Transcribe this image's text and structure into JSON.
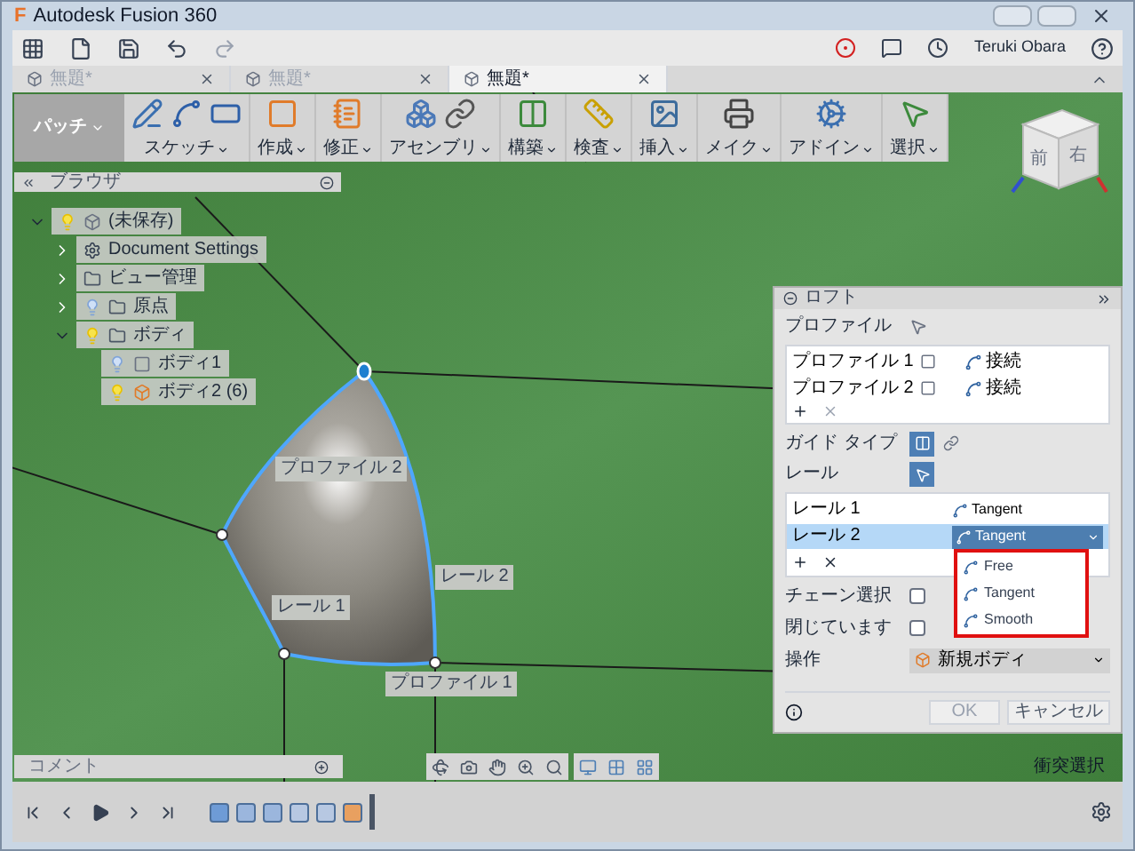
{
  "window": {
    "logo": "F",
    "title": "Autodesk Fusion 360"
  },
  "toolbar": {
    "user": "Teruki Obara"
  },
  "tabs": [
    {
      "label": "無題*",
      "selected": false
    },
    {
      "label": "無題*",
      "selected": false
    },
    {
      "label": "無題*",
      "selected": true
    }
  ],
  "ribbon": {
    "workspace": "パッチ",
    "groups": [
      {
        "label": "スケッチ",
        "kind": "sketch"
      },
      {
        "label": "作成",
        "kind": "create"
      },
      {
        "label": "修正",
        "kind": "modify"
      },
      {
        "label": "アセンブリ",
        "kind": "assemble"
      },
      {
        "label": "構築",
        "kind": "construct"
      },
      {
        "label": "検査",
        "kind": "inspect"
      },
      {
        "label": "挿入",
        "kind": "insert"
      },
      {
        "label": "メイク",
        "kind": "make"
      },
      {
        "label": "アドイン",
        "kind": "addins"
      },
      {
        "label": "選択",
        "kind": "select"
      }
    ]
  },
  "viewcube": {
    "faces": [
      "前",
      "右"
    ]
  },
  "browser": {
    "title": "ブラウザ",
    "tree": [
      {
        "label": "(未保存)",
        "kind": "component",
        "visible": true,
        "expanded": true,
        "children": [
          {
            "label": "Document Settings",
            "kind": "settings",
            "expanded": false
          },
          {
            "label": "ビュー管理",
            "kind": "folder",
            "expanded": false
          },
          {
            "label": "原点",
            "kind": "folder",
            "visible": false,
            "expanded": false
          },
          {
            "label": "ボディ",
            "kind": "folder",
            "visible": true,
            "expanded": true,
            "children": [
              {
                "label": "ボディ1",
                "kind": "body",
                "visible": false
              },
              {
                "label": "ボディ2 (6)",
                "kind": "body-orange",
                "visible": true
              }
            ]
          }
        ]
      }
    ]
  },
  "canvas_labels": [
    {
      "text": "プロファイル 2"
    },
    {
      "text": "レール 1"
    },
    {
      "text": "レール 2"
    },
    {
      "text": "プロファイル 1"
    }
  ],
  "loft": {
    "title": "ロフト",
    "profile_label": "プロファイル",
    "profiles": [
      {
        "name": "プロファイル 1",
        "condition": "接続"
      },
      {
        "name": "プロファイル 2",
        "condition": "接続"
      }
    ],
    "guide_type_label": "ガイド タイプ",
    "guide_types": [
      {
        "kind": "rails",
        "selected": true
      },
      {
        "kind": "centerline",
        "selected": false
      }
    ],
    "rail_label": "レール",
    "rails": [
      {
        "name": "レール 1",
        "condition": "Tangent",
        "selected": false
      },
      {
        "name": "レール 2",
        "condition": "Tangent",
        "selected": true
      }
    ],
    "dropdown_options": [
      {
        "label": "Free"
      },
      {
        "label": "Tangent"
      },
      {
        "label": "Smooth"
      }
    ],
    "chain_select": {
      "label": "チェーン選択",
      "checked": false
    },
    "closed": {
      "label": "閉じています",
      "checked": false
    },
    "operation": {
      "label": "操作",
      "value": "新規ボディ"
    },
    "buttons": [
      "OK",
      "キャンセル"
    ]
  },
  "comments": {
    "title": "コメント"
  },
  "status_text": "衝突選択"
}
